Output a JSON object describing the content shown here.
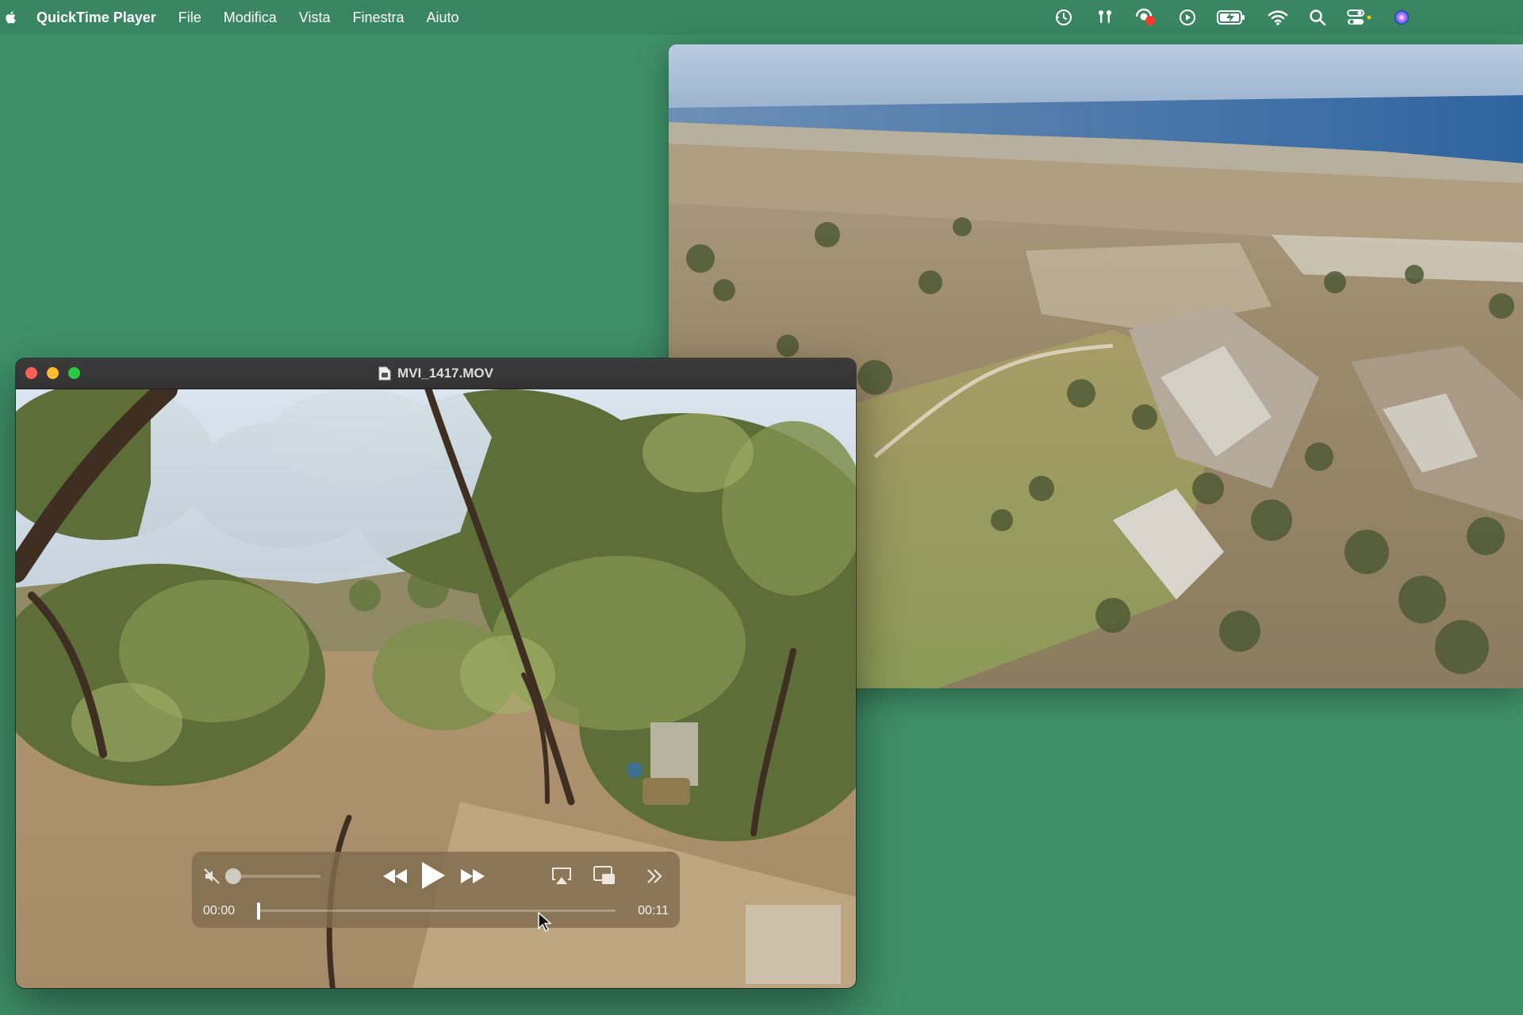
{
  "menubar": {
    "app_name": "QuickTime Player",
    "items": [
      "File",
      "Modifica",
      "Vista",
      "Finestra",
      "Aiuto"
    ],
    "status_icons": [
      "time-machine-icon",
      "airpods-icon",
      "screen-recording-icon",
      "play-circle-icon",
      "battery-charging-icon",
      "wifi-icon",
      "spotlight-search-icon",
      "control-center-icon",
      "siri-icon"
    ]
  },
  "player": {
    "title": "MVI_1417.MOV",
    "controls": {
      "current_time": "00:00",
      "duration": "00:11",
      "progress": 0.0,
      "volume": 0.0,
      "muted": true
    }
  },
  "colors": {
    "desktop": "#3f9069",
    "menubar": "#3a8662",
    "close": "#ff5f57",
    "minimize": "#febc2e",
    "zoom": "#28c840",
    "recording_dot": "#ff3b30"
  }
}
